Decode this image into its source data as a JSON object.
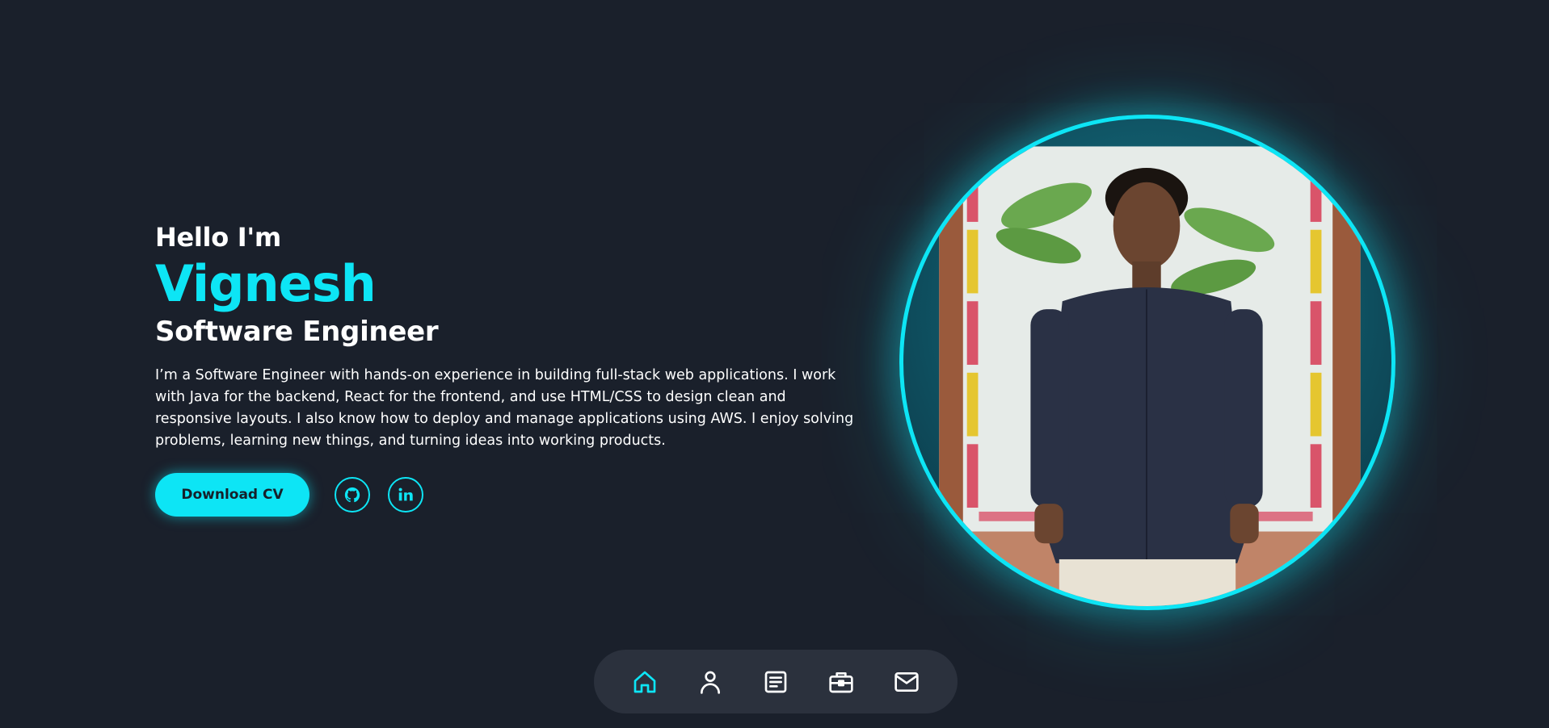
{
  "hero": {
    "greeting": "Hello I'm",
    "name": "Vignesh",
    "role": "Software Engineer",
    "bio": "I’m a Software Engineer with hands-on experience in building full-stack web applications. I work with Java for the backend, React for the frontend, and use HTML/CSS to design clean and responsive layouts. I also know how to deploy and manage applications using AWS. I enjoy solving problems, learning new things, and turning ideas into working products.",
    "download_label": "Download CV"
  },
  "social": [
    {
      "icon": "github-icon"
    },
    {
      "icon": "linkedin-icon"
    }
  ],
  "nav": {
    "items": [
      {
        "icon": "home-icon",
        "active": true
      },
      {
        "icon": "user-icon",
        "active": false
      },
      {
        "icon": "document-icon",
        "active": false
      },
      {
        "icon": "briefcase-icon",
        "active": false
      },
      {
        "icon": "mail-icon",
        "active": false
      }
    ]
  },
  "colors": {
    "background": "#1a202b",
    "accent": "#0de5f5",
    "nav_background": "#2b313d",
    "text": "#ffffff"
  }
}
